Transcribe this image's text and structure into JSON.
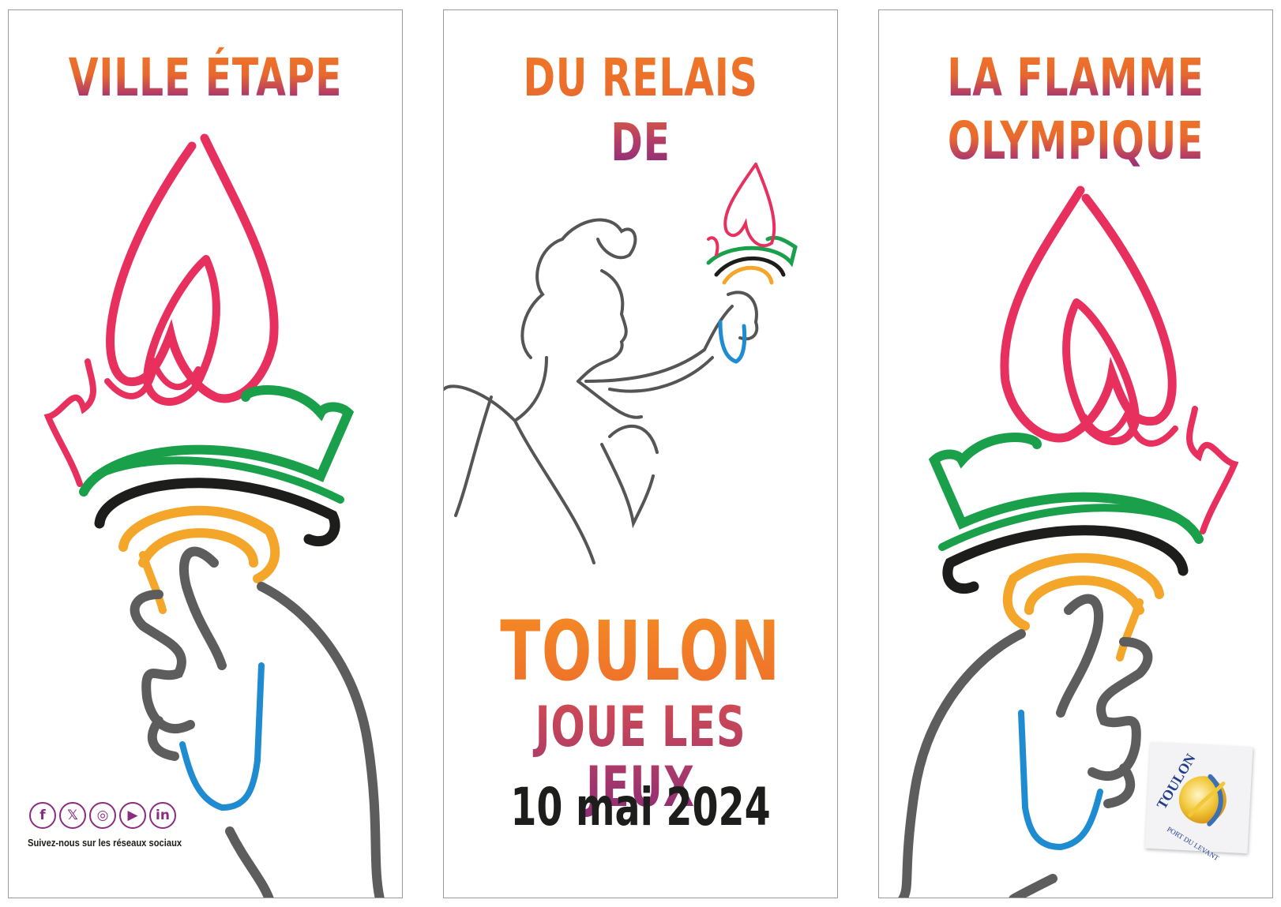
{
  "panel_left": {
    "headline": "VILLE ÉTAPE",
    "social": {
      "icons": [
        "facebook-icon",
        "x-icon",
        "instagram-icon",
        "youtube-icon",
        "linkedin-icon"
      ],
      "glyphs": {
        "facebook": "f",
        "x": "𝕏",
        "instagram": "◎",
        "youtube": "▶",
        "linkedin": "in"
      },
      "caption": "Suivez-nous sur les réseaux sociaux"
    }
  },
  "panel_center": {
    "headline": "DU RELAIS DE",
    "title": "TOULON",
    "subtitle": "JOUE LES JEUX",
    "date": "10 mai 2024"
  },
  "panel_right": {
    "headline_line1": "LA FLAMME",
    "headline_line2": "OLYMPIQUE",
    "logo": {
      "name": "TOULON",
      "tagline": "PORT DU LEVANT"
    }
  },
  "colors": {
    "title_orange": "#f07a25",
    "title_purple": "#7d2a7e",
    "flame_red": "#e8305e",
    "ring_green": "#1aa04a",
    "ring_black": "#1d1d1b",
    "ring_yellow": "#f4a62a",
    "ring_blue": "#1f8bd1",
    "hand_gray": "#5d5d5d"
  }
}
